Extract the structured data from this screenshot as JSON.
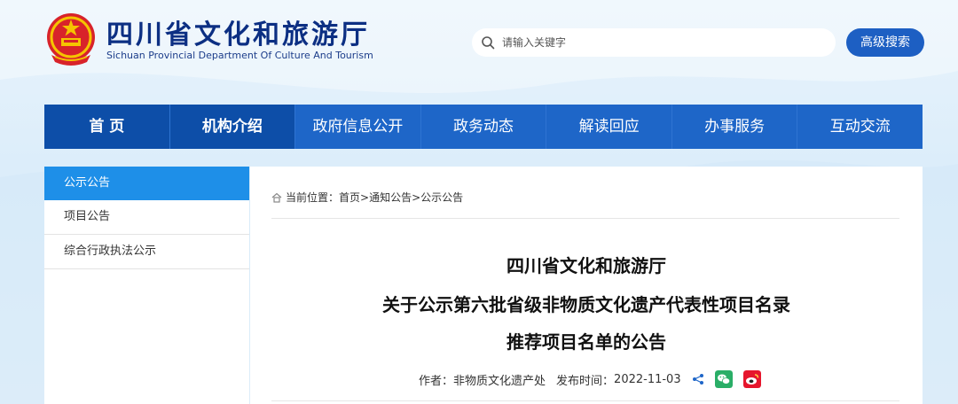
{
  "header": {
    "title": "四川省文化和旅游厅",
    "subtitle": "Sichuan Provincial Department Of Culture And Tourism",
    "emblem_icon": "national-emblem-icon"
  },
  "search": {
    "placeholder": "请输入关键字",
    "icon": "search-icon",
    "advanced_label": "高级搜索"
  },
  "nav": {
    "items": [
      {
        "label": "首 页"
      },
      {
        "label": "机构介绍"
      },
      {
        "label": "政府信息公开"
      },
      {
        "label": "政务动态"
      },
      {
        "label": "解读回应"
      },
      {
        "label": "办事服务"
      },
      {
        "label": "互动交流"
      }
    ]
  },
  "sidebar": {
    "items": [
      {
        "label": "公示公告"
      },
      {
        "label": "项目公告"
      },
      {
        "label": "综合行政执法公示"
      }
    ]
  },
  "breadcrumb": {
    "prefix": "当前位置：",
    "items": [
      "首页",
      "通知公告",
      "公示公告"
    ],
    "separator": ">"
  },
  "article": {
    "title_lines": [
      "四川省文化和旅游厅",
      "关于公示第六批省级非物质文化遗产代表性项目名录",
      "推荐项目名单的公告"
    ],
    "author_label": "作者：",
    "author": "非物质文化遗产处",
    "date_label": "发布时间：",
    "date": "2022-11-03"
  },
  "colors": {
    "nav_bg": "#1e66c8",
    "nav_active": "#0d4ea8",
    "title_blue": "#0c2f83",
    "sidebar_active": "#1e8fe8",
    "wechat_green": "#2aae67",
    "weibo_red": "#e6162d"
  }
}
